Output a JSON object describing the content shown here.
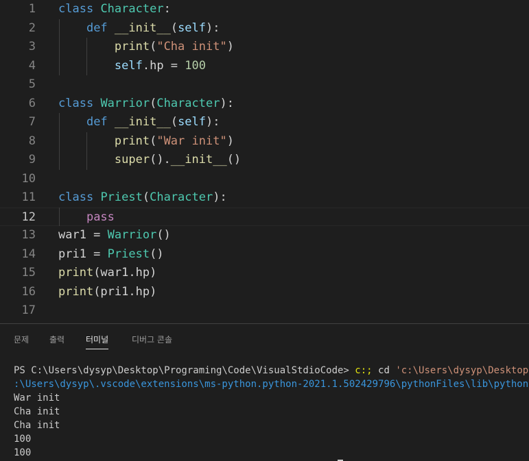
{
  "editor": {
    "current_line": 12,
    "line_numbers": [
      "1",
      "2",
      "3",
      "4",
      "5",
      "6",
      "7",
      "8",
      "9",
      "10",
      "11",
      "12",
      "13",
      "14",
      "15",
      "16",
      "17"
    ],
    "lines": [
      [
        {
          "t": "class",
          "c": "kw"
        },
        {
          "t": " ",
          "c": "plain"
        },
        {
          "t": "Character",
          "c": "cls"
        },
        {
          "t": ":",
          "c": "plain"
        }
      ],
      [
        {
          "t": "    ",
          "c": "plain"
        },
        {
          "t": "def",
          "c": "kw"
        },
        {
          "t": " ",
          "c": "plain"
        },
        {
          "t": "__init__",
          "c": "fn"
        },
        {
          "t": "(",
          "c": "plain"
        },
        {
          "t": "self",
          "c": "var"
        },
        {
          "t": "):",
          "c": "plain"
        }
      ],
      [
        {
          "t": "        ",
          "c": "plain"
        },
        {
          "t": "print",
          "c": "fn"
        },
        {
          "t": "(",
          "c": "plain"
        },
        {
          "t": "\"Cha init\"",
          "c": "str"
        },
        {
          "t": ")",
          "c": "plain"
        }
      ],
      [
        {
          "t": "        ",
          "c": "plain"
        },
        {
          "t": "self",
          "c": "var"
        },
        {
          "t": ".hp = ",
          "c": "plain"
        },
        {
          "t": "100",
          "c": "num"
        }
      ],
      [],
      [
        {
          "t": "class",
          "c": "kw"
        },
        {
          "t": " ",
          "c": "plain"
        },
        {
          "t": "Warrior",
          "c": "cls"
        },
        {
          "t": "(",
          "c": "plain"
        },
        {
          "t": "Character",
          "c": "cls"
        },
        {
          "t": "):",
          "c": "plain"
        }
      ],
      [
        {
          "t": "    ",
          "c": "plain"
        },
        {
          "t": "def",
          "c": "kw"
        },
        {
          "t": " ",
          "c": "plain"
        },
        {
          "t": "__init__",
          "c": "fn"
        },
        {
          "t": "(",
          "c": "plain"
        },
        {
          "t": "self",
          "c": "var"
        },
        {
          "t": "):",
          "c": "plain"
        }
      ],
      [
        {
          "t": "        ",
          "c": "plain"
        },
        {
          "t": "print",
          "c": "fn"
        },
        {
          "t": "(",
          "c": "plain"
        },
        {
          "t": "\"War init\"",
          "c": "str"
        },
        {
          "t": ")",
          "c": "plain"
        }
      ],
      [
        {
          "t": "        ",
          "c": "plain"
        },
        {
          "t": "super",
          "c": "fn"
        },
        {
          "t": "().",
          "c": "plain"
        },
        {
          "t": "__init__",
          "c": "fn"
        },
        {
          "t": "()",
          "c": "plain"
        }
      ],
      [],
      [
        {
          "t": "class",
          "c": "kw"
        },
        {
          "t": " ",
          "c": "plain"
        },
        {
          "t": "Priest",
          "c": "cls"
        },
        {
          "t": "(",
          "c": "plain"
        },
        {
          "t": "Character",
          "c": "cls"
        },
        {
          "t": "):",
          "c": "plain"
        }
      ],
      [
        {
          "t": "    ",
          "c": "plain"
        },
        {
          "t": "pass",
          "c": "ctl"
        }
      ],
      [
        {
          "t": "war1 = ",
          "c": "plain"
        },
        {
          "t": "Warrior",
          "c": "cls"
        },
        {
          "t": "()",
          "c": "plain"
        }
      ],
      [
        {
          "t": "pri1 = ",
          "c": "plain"
        },
        {
          "t": "Priest",
          "c": "cls"
        },
        {
          "t": "()",
          "c": "plain"
        }
      ],
      [
        {
          "t": "print",
          "c": "fn"
        },
        {
          "t": "(war1.hp)",
          "c": "plain"
        }
      ],
      [
        {
          "t": "print",
          "c": "fn"
        },
        {
          "t": "(pri1.hp)",
          "c": "plain"
        }
      ],
      []
    ]
  },
  "panel": {
    "tabs": [
      {
        "label": "문제",
        "active": false
      },
      {
        "label": "출력",
        "active": false
      },
      {
        "label": "터미널",
        "active": true
      },
      {
        "label": "디버그 콘솔",
        "active": false
      }
    ],
    "terminal": {
      "prompt": "PS C:\\Users\\dysyp\\Desktop\\Programing\\Code\\VisualStdioCode>",
      "cmd_part1": " c:; ",
      "cmd_part2": "cd ",
      "cmd_path": "'c:\\Users\\dysyp\\Desktop\\Pro",
      "path_cont": ":\\Users\\dysyp\\.vscode\\extensions\\ms-python.python-2021.1.502429796\\pythonFiles\\lib\\python\\debu",
      "output": [
        "War init",
        "Cha init",
        "Cha init",
        "100",
        "100"
      ]
    }
  }
}
